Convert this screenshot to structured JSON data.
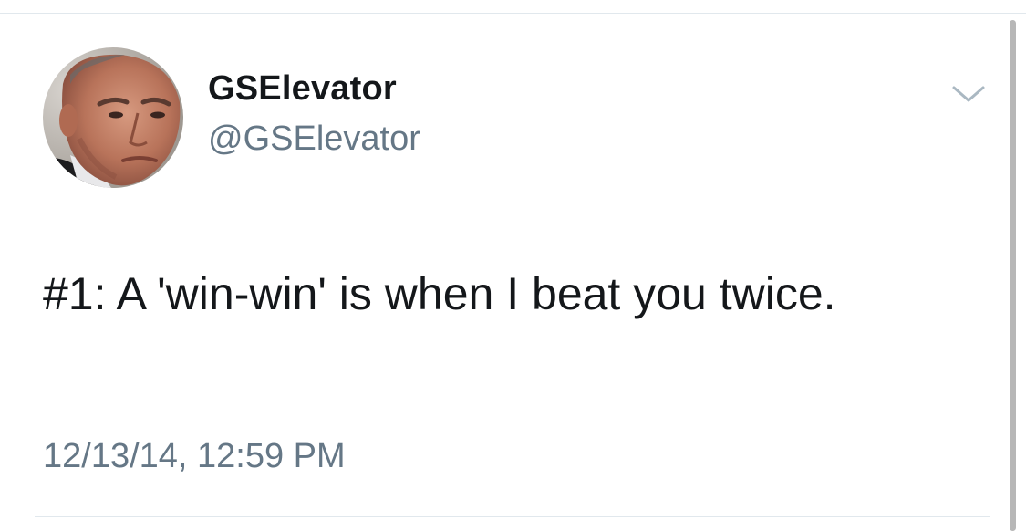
{
  "tweet": {
    "display_name": "GSElevator",
    "handle": "@GSElevator",
    "text": "#1: A 'win-win' is when I beat you twice.",
    "timestamp": "12/13/14, 12:59 PM"
  },
  "icons": {
    "menu": "chevron-down-icon"
  },
  "colors": {
    "text_primary": "#14171a",
    "text_secondary": "#657786",
    "divider": "#e1e8ed",
    "scrollbar": "#b7b7b7"
  }
}
